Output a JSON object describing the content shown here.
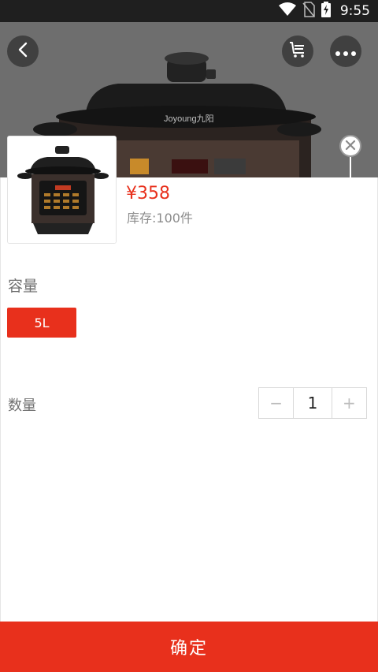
{
  "status_bar": {
    "time": "9:55"
  },
  "hero": {
    "brand_text": "Joyoung九阳"
  },
  "product": {
    "price": "¥358",
    "stock": "库存:100件"
  },
  "spec": {
    "title": "容量",
    "selected_option": "5L"
  },
  "quantity": {
    "label": "数量",
    "value": "1",
    "minus": "−",
    "plus": "+"
  },
  "confirm_label": "确定",
  "colors": {
    "accent": "#e8301c",
    "status_bar": "#1f1f1f",
    "muted_text": "#8c8c8c"
  }
}
